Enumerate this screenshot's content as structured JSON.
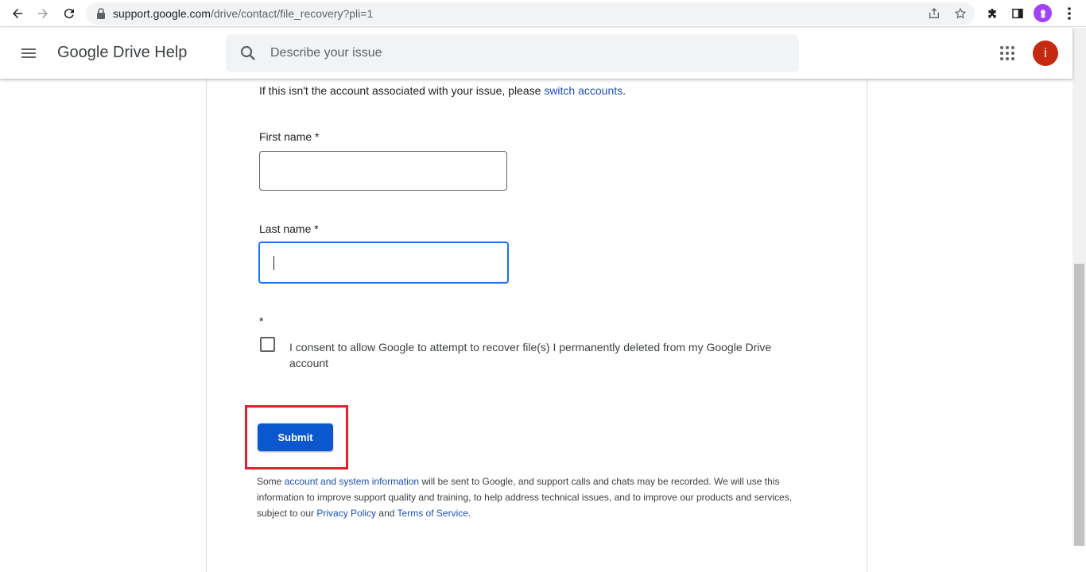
{
  "browser": {
    "url_host": "support.google.com",
    "url_path": "/drive/contact/file_recovery?pli=1",
    "icons": [
      "back-icon",
      "forward-icon",
      "reload-icon",
      "lock-icon",
      "share-icon",
      "star-icon",
      "extensions-icon",
      "side-panel-icon",
      "profile-icon",
      "more-icon"
    ]
  },
  "header": {
    "title": "Google Drive Help",
    "search_placeholder": "Describe your issue",
    "avatar_letter": "i"
  },
  "form": {
    "account_text": "If this isn't the account associated with your issue, please ",
    "switch_link": "switch accounts",
    "account_text_end": ".",
    "first_name_label": "First name *",
    "last_name_label": "Last name *",
    "required_mark": "*",
    "consent_label": "I consent to allow Google to attempt to recover file(s) I permanently deleted from my Google Drive account",
    "submit_label": "Submit"
  },
  "disclaimer": {
    "part1": "Some ",
    "link1": "account and system information",
    "part2": " will be sent to Google, and support calls and chats may be recorded. We will use this information to improve support quality and training, to help address technical issues, and to improve our products and services, subject to our ",
    "link2": "Privacy Policy",
    "part3": " and ",
    "link3": "Terms of Service",
    "part4": "."
  },
  "colors": {
    "accent": "#0b57d0",
    "link": "#1a4fb5",
    "highlight": "#e0202a",
    "avatar": "#c5290f"
  }
}
